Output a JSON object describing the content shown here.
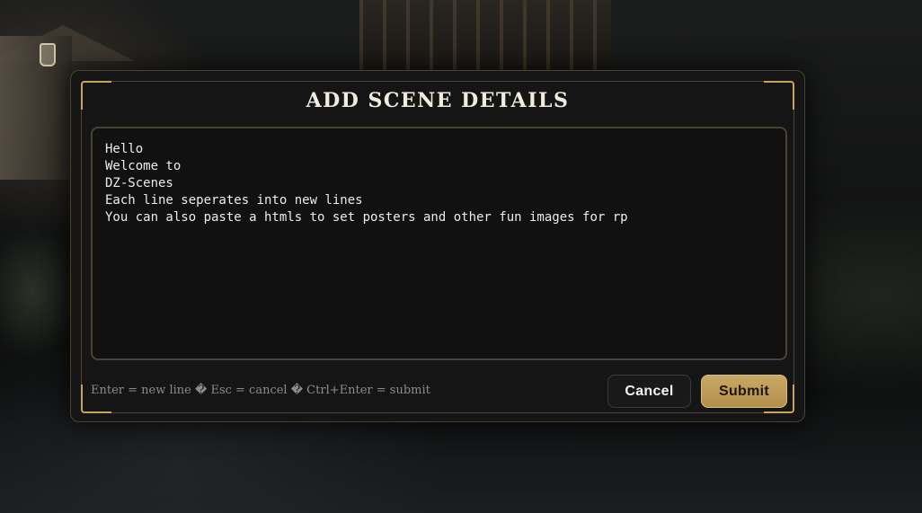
{
  "modal": {
    "title": "ADD SCENE DETAILS",
    "text_value": "Hello\nWelcome to\nDZ-Scenes\nEach line seperates into new lines\nYou can also paste a htmls to set posters and other fun images for rp",
    "hint": "Enter = new line � Esc = cancel � Ctrl+Enter = submit",
    "cancel_label": "Cancel",
    "submit_label": "Submit"
  },
  "colors": {
    "accent_gold": "#c7a45e",
    "submit_bg": "#c2a060",
    "panel_bg": "#151515"
  }
}
